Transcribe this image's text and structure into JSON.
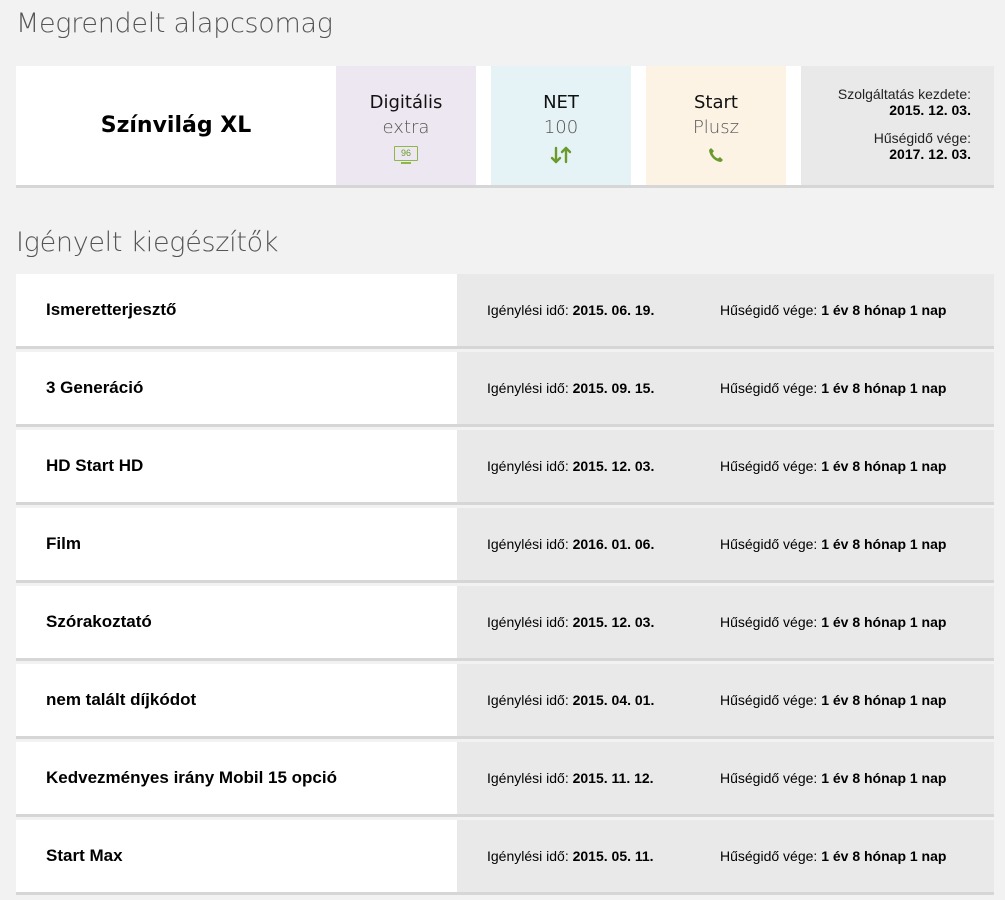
{
  "sections": {
    "package_title": "Megrendelt alapcsomag",
    "addons_title": "Igényelt kiegészítők"
  },
  "package": {
    "name": "Színvilág XL",
    "tiles": {
      "tv": {
        "title": "Digitális",
        "subtitle": "extra",
        "icon": "tv-icon",
        "icon_text": "96",
        "bg": "#ede7f2"
      },
      "net": {
        "title": "NET",
        "subtitle": "100",
        "icon": "up-down-arrows-icon",
        "bg": "#e6f3f6"
      },
      "start": {
        "title": "Start",
        "subtitle": "Plusz",
        "icon": "phone-icon",
        "bg": "#fcf3e5"
      }
    },
    "service_start_label": "Szolgáltatás kezdete:",
    "service_start_value": "2015. 12. 03.",
    "loyalty_end_label": "Hűségidő vége:",
    "loyalty_end_value": "2017. 12. 03."
  },
  "addon_labels": {
    "request_label": "Igénylési idő:",
    "loyalty_label": "Hűségidő vége:"
  },
  "addons": [
    {
      "name": "Ismeretterjesztő",
      "request_date": "2015. 06. 19.",
      "loyalty": "1 év 8 hónap 1 nap"
    },
    {
      "name": "3 Generáció",
      "request_date": "2015. 09. 15.",
      "loyalty": "1 év 8 hónap 1 nap"
    },
    {
      "name": "HD Start HD",
      "request_date": "2015. 12. 03.",
      "loyalty": "1 év 8 hónap 1 nap"
    },
    {
      "name": "Film",
      "request_date": "2016. 01. 06.",
      "loyalty": "1 év 8 hónap 1 nap"
    },
    {
      "name": "Szórakoztató",
      "request_date": "2015. 12. 03.",
      "loyalty": "1 év 8 hónap 1 nap"
    },
    {
      "name": "nem talált díjkódot",
      "request_date": "2015. 04. 01.",
      "loyalty": "1 év 8 hónap 1 nap"
    },
    {
      "name": "Kedvezményes irány Mobil 15 opció",
      "request_date": "2015. 11. 12.",
      "loyalty": "1 év 8 hónap 1 nap"
    },
    {
      "name": "Start Max",
      "request_date": "2015. 05. 11.",
      "loyalty": "1 év 8 hónap 1 nap"
    }
  ],
  "colors": {
    "accent_green": "#6a9a2c",
    "panel_grey": "#e9e9e9"
  }
}
